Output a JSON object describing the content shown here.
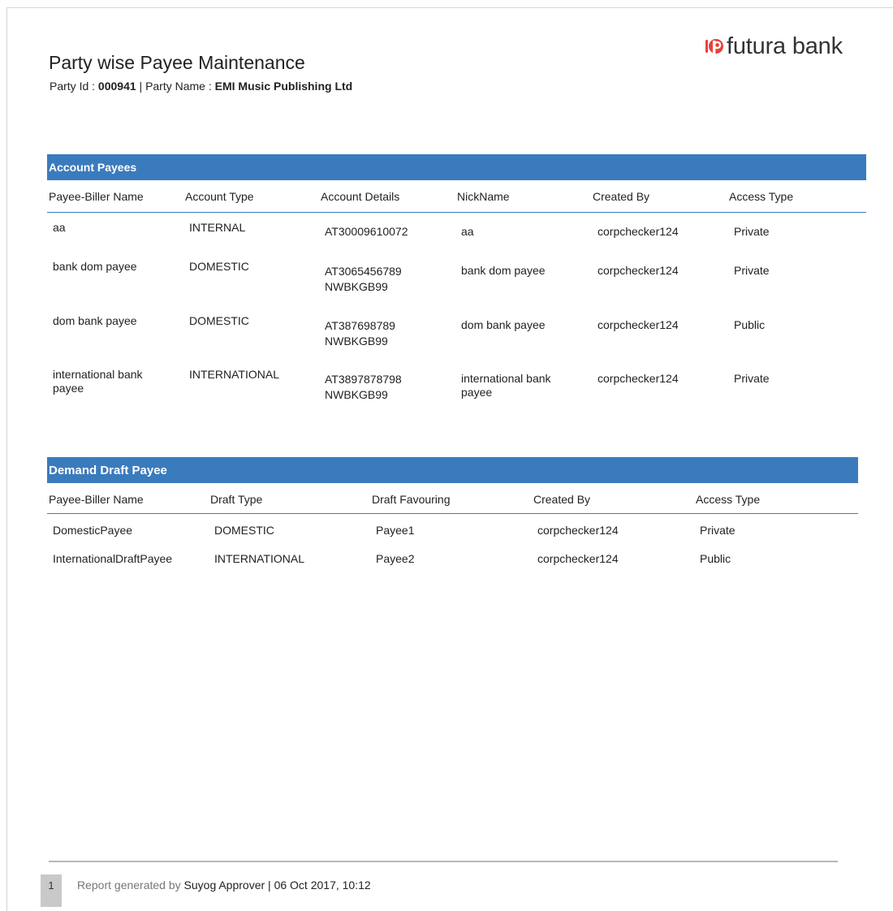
{
  "brand": {
    "name": "futura bank",
    "accent": "#e8413b"
  },
  "report": {
    "title": "Party wise Payee Maintenance",
    "party_id_label": "Party Id : ",
    "party_id": "000941",
    "separator": " | ",
    "party_name_label": "Party Name : ",
    "party_name": "EMI Music Publishing Ltd"
  },
  "account_payees": {
    "title": "Account Payees",
    "columns": [
      "Payee-Biller Name",
      "Account Type",
      "Account Details",
      "NickName",
      "Created By",
      "Access Type"
    ],
    "rows": [
      {
        "name": [
          "aa"
        ],
        "type": "INTERNAL",
        "details": [
          "AT30009610072"
        ],
        "nick": [
          "aa"
        ],
        "created_by": "corpchecker124",
        "access": "Private"
      },
      {
        "name": [
          "bank dom payee"
        ],
        "type": "DOMESTIC",
        "details": [
          "AT3065456789",
          "NWBKGB99"
        ],
        "nick": [
          "bank dom payee"
        ],
        "created_by": "corpchecker124",
        "access": "Private"
      },
      {
        "name": [
          "dom bank payee"
        ],
        "type": "DOMESTIC",
        "details": [
          "AT387698789",
          "NWBKGB99"
        ],
        "nick": [
          "dom bank payee"
        ],
        "created_by": "corpchecker124",
        "access": "Public"
      },
      {
        "name": [
          "international bank",
          "payee"
        ],
        "type": "INTERNATIONAL",
        "details": [
          "AT3897878798",
          "NWBKGB99"
        ],
        "nick": [
          "international bank",
          "payee"
        ],
        "created_by": "corpchecker124",
        "access": "Private"
      }
    ]
  },
  "demand_draft_payees": {
    "title": "Demand Draft Payee",
    "columns": [
      "Payee-Biller Name",
      "Draft Type",
      "Draft Favouring",
      "Created By",
      "Access Type"
    ],
    "rows": [
      {
        "name": "DomesticPayee",
        "type": "DOMESTIC",
        "favouring": "Payee1",
        "created_by": "corpchecker124",
        "access": "Private"
      },
      {
        "name": "InternationalDraftPayee",
        "type": "INTERNATIONAL",
        "favouring": "Payee2",
        "created_by": "corpchecker124",
        "access": "Public"
      }
    ]
  },
  "footer": {
    "page_number": "1",
    "generated_label": "Report generated by ",
    "generated_by": "Suyog Approver",
    "separator": " | ",
    "generated_at": "06 Oct 2017, 10:12"
  }
}
